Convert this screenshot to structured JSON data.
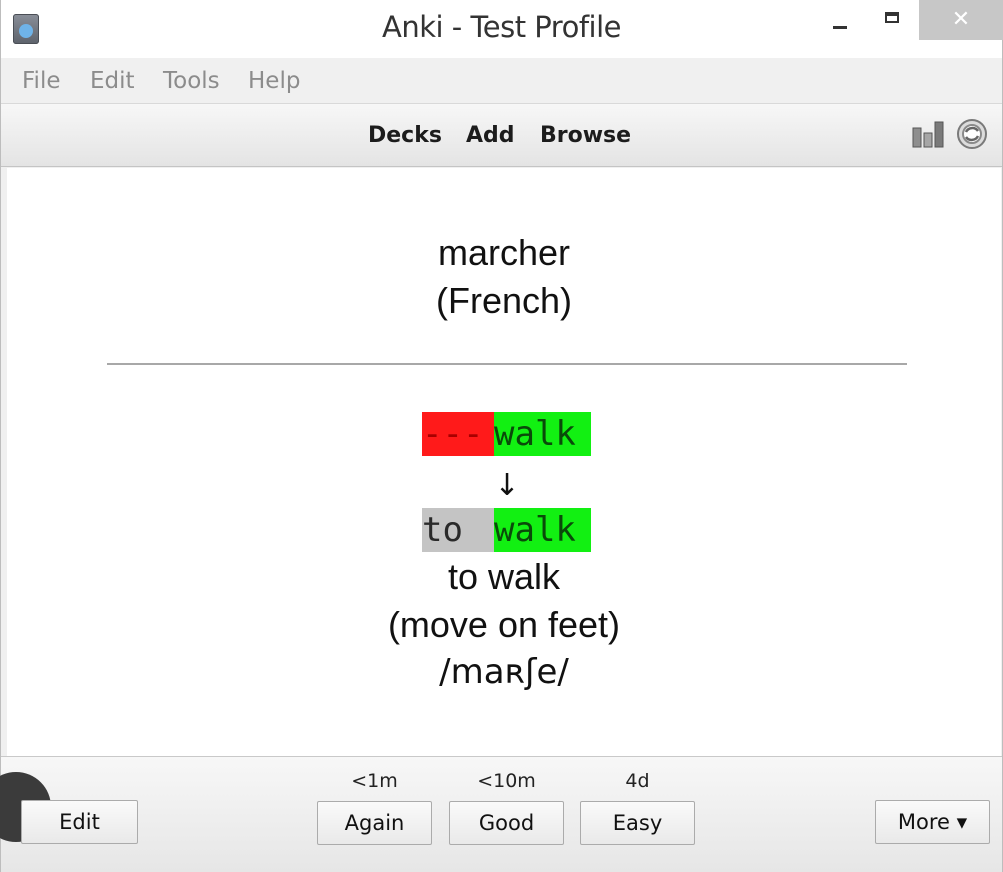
{
  "window": {
    "title": "Anki - Test Profile",
    "close_glyph": "✕",
    "colors": {
      "close_bg": "#c7c7c7",
      "titlebar_bg": "#ffffff"
    }
  },
  "menu": {
    "items": [
      "File",
      "Edit",
      "Tools",
      "Help"
    ]
  },
  "toolbar": {
    "links": [
      "Decks",
      "Add",
      "Browse"
    ],
    "icons": [
      "stats-icon",
      "sync-icon"
    ]
  },
  "card": {
    "front_word": "marcher",
    "front_language": "(French)",
    "typed_answer": {
      "missing": "---",
      "match": "walk"
    },
    "arrow": "↓",
    "correct_answer": {
      "missing": "to ",
      "match": "walk"
    },
    "meaning": "to walk",
    "meaning_note": "(move on feet)",
    "ipa": "/maʀʃe/",
    "colors": {
      "wrong": "#ff1a1a",
      "right": "#12f012",
      "missing": "#c4c4c4"
    }
  },
  "answer_bar": {
    "edit_label": "Edit",
    "more_label": "More ▾",
    "buttons": [
      {
        "label": "Again",
        "interval": "<1m"
      },
      {
        "label": "Good",
        "interval": "<10m"
      },
      {
        "label": "Easy",
        "interval": "4d"
      }
    ]
  }
}
